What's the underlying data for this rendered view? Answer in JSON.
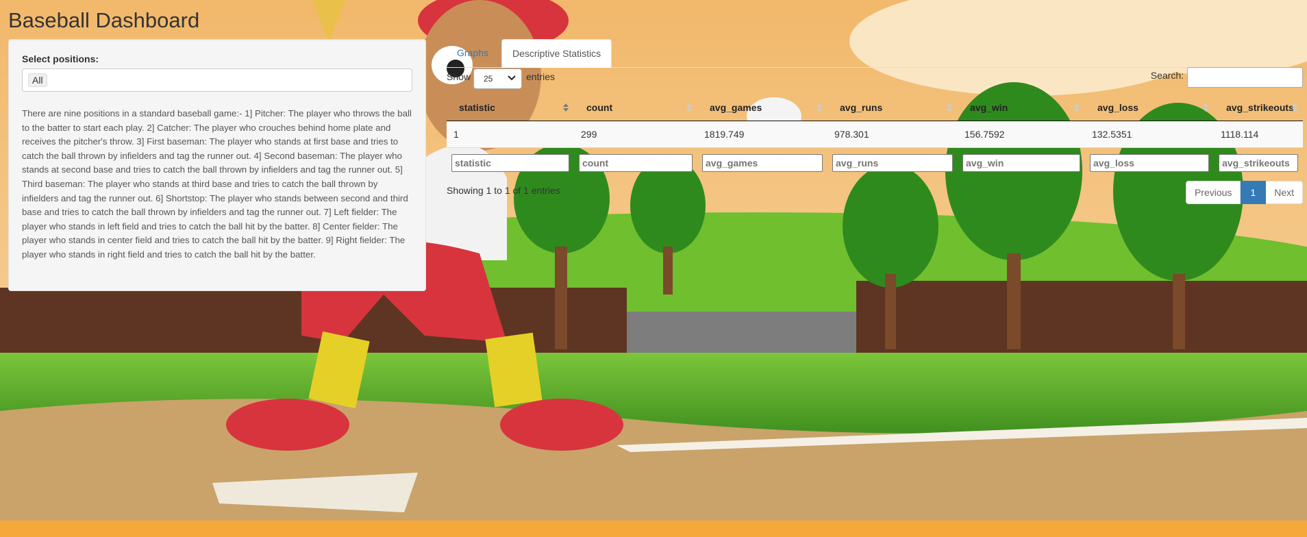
{
  "app": {
    "title": "Baseball Dashboard"
  },
  "sidebar": {
    "select_label": "Select positions:",
    "selected_value": "All",
    "description": "There are nine positions in a standard baseball game:- 1] Pitcher: The player who throws the ball to the batter to start each play. 2] Catcher: The player who crouches behind home plate and receives the pitcher's throw. 3] First baseman: The player who stands at first base and tries to catch the ball thrown by infielders and tag the runner out. 4] Second baseman: The player who stands at second base and tries to catch the ball thrown by infielders and tag the runner out. 5] Third baseman: The player who stands at third base and tries to catch the ball thrown by infielders and tag the runner out. 6] Shortstop: The player who stands between second and third base and tries to catch the ball thrown by infielders and tag the runner out. 7] Left fielder: The player who stands in left field and tries to catch the ball hit by the batter. 8] Center fielder: The player who stands in center field and tries to catch the ball hit by the batter. 9] Right fielder: The player who stands in right field and tries to catch the ball hit by the batter."
  },
  "tabs": [
    {
      "label": "Graphs"
    },
    {
      "label": "Descriptive Statistics"
    }
  ],
  "table_controls": {
    "show_label": "Show",
    "page_length": "25",
    "entries_label": "entries",
    "search_label": "Search:",
    "search_value": ""
  },
  "table": {
    "columns": [
      "statistic",
      "count",
      "avg_games",
      "avg_runs",
      "avg_win",
      "avg_loss",
      "avg_strikeouts"
    ],
    "rows": [
      [
        "1",
        "299",
        "1819.749",
        "978.301",
        "156.7592",
        "132.5351",
        "1118.114"
      ]
    ],
    "filters": [
      "statistic",
      "count",
      "avg_games",
      "avg_runs",
      "avg_win",
      "avg_loss",
      "avg_strikeouts"
    ]
  },
  "footer": {
    "info": "Showing 1 to 1 of 1 entries",
    "previous": "Previous",
    "current_page": "1",
    "next": "Next"
  },
  "colors": {
    "sky_top": "#f3c07a",
    "grass": "#5fae2e",
    "dirt": "#c9a36a",
    "bottom_bar": "#f7a83a",
    "accent": "#337ab7"
  }
}
